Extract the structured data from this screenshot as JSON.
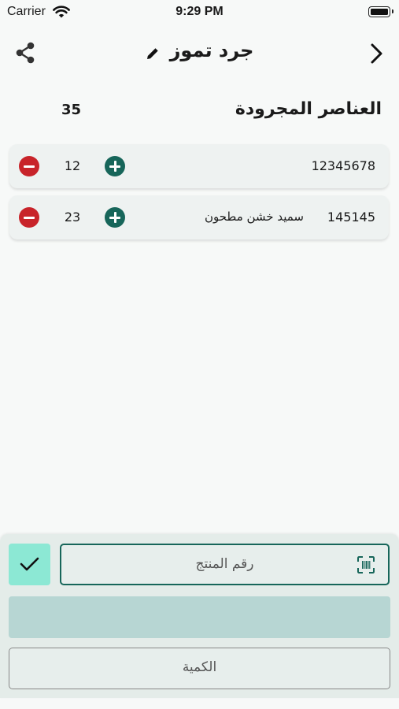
{
  "status_bar": {
    "carrier": "Carrier",
    "time": "9:29 PM"
  },
  "header": {
    "title": "جرد تموز"
  },
  "summary": {
    "label": "العناصر المجرودة",
    "total": "35"
  },
  "items": [
    {
      "code": "12345678",
      "name": "",
      "quantity": "12"
    },
    {
      "code": "145145",
      "name": "سميد خشن مطحون",
      "quantity": "23"
    }
  ],
  "form": {
    "product_placeholder": "رقم المنتج",
    "quantity_placeholder": "الكمية"
  },
  "colors": {
    "accent": "#17665a",
    "danger": "#c8242a",
    "confirm": "#8ce8d4"
  },
  "icons": [
    "wifi-icon",
    "battery-icon",
    "share-icon",
    "pencil-icon",
    "chevron-right-icon",
    "minus-circle-icon",
    "plus-circle-icon",
    "checkmark-icon",
    "barcode-scan-icon"
  ]
}
